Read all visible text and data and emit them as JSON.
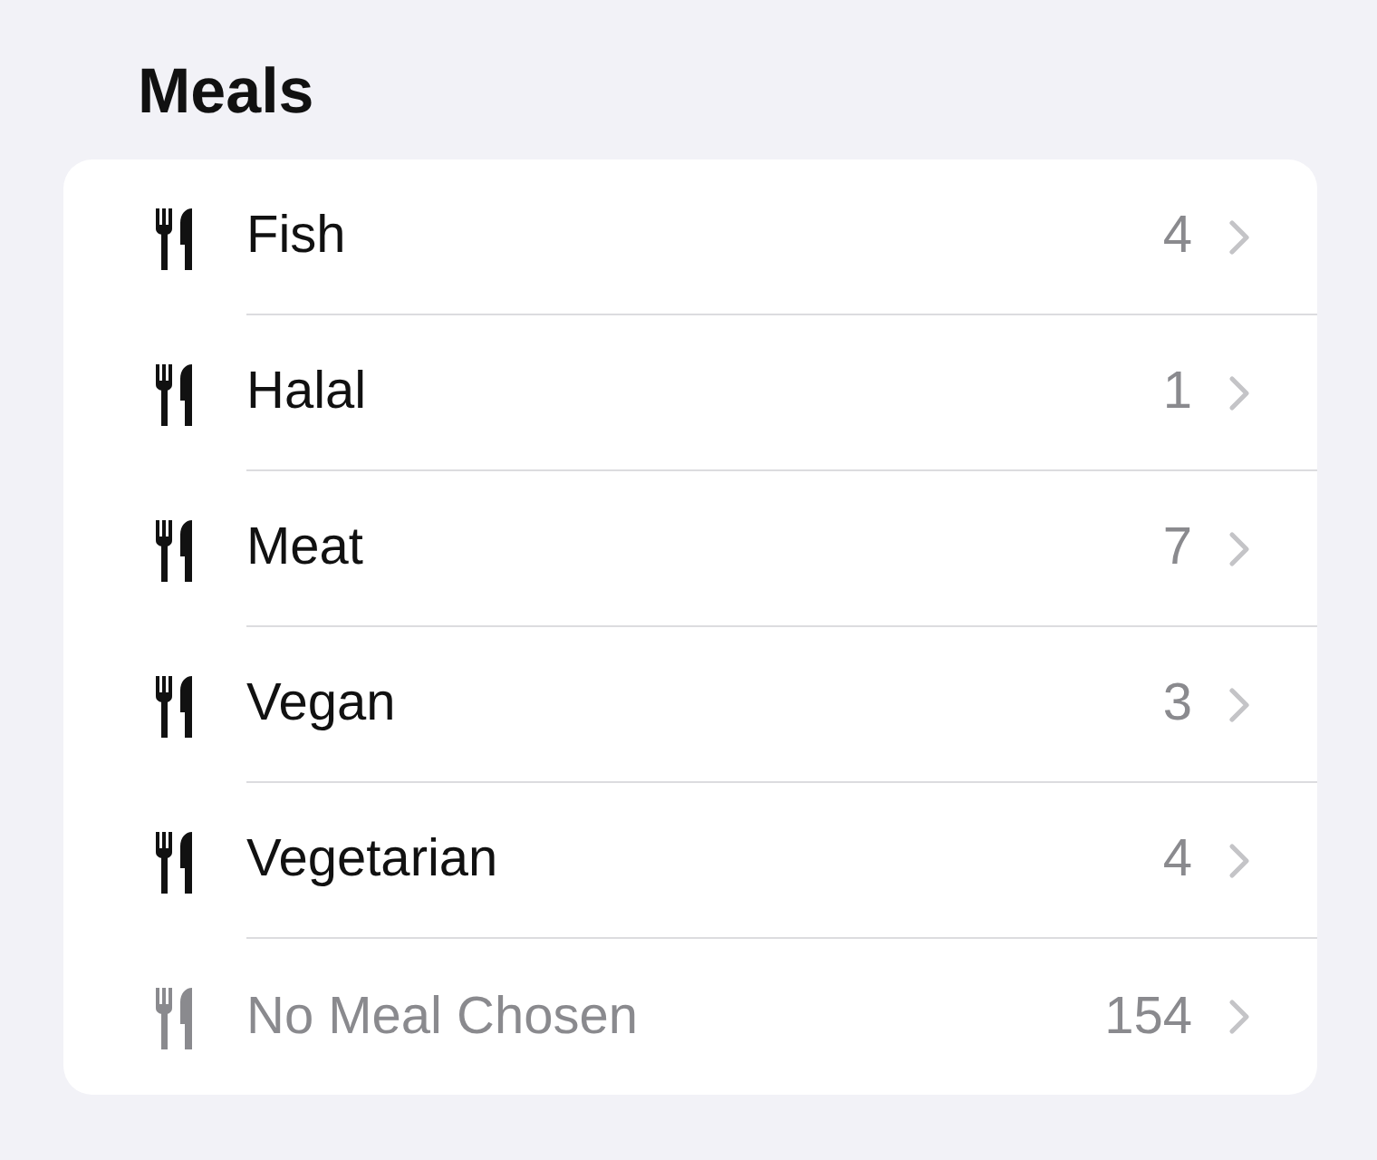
{
  "title": "Meals",
  "items": [
    {
      "label": "Fish",
      "count": "4",
      "disabled": false
    },
    {
      "label": "Halal",
      "count": "1",
      "disabled": false
    },
    {
      "label": "Meat",
      "count": "7",
      "disabled": false
    },
    {
      "label": "Vegan",
      "count": "3",
      "disabled": false
    },
    {
      "label": "Vegetarian",
      "count": "4",
      "disabled": false
    },
    {
      "label": "No Meal Chosen",
      "count": "154",
      "disabled": true
    }
  ]
}
